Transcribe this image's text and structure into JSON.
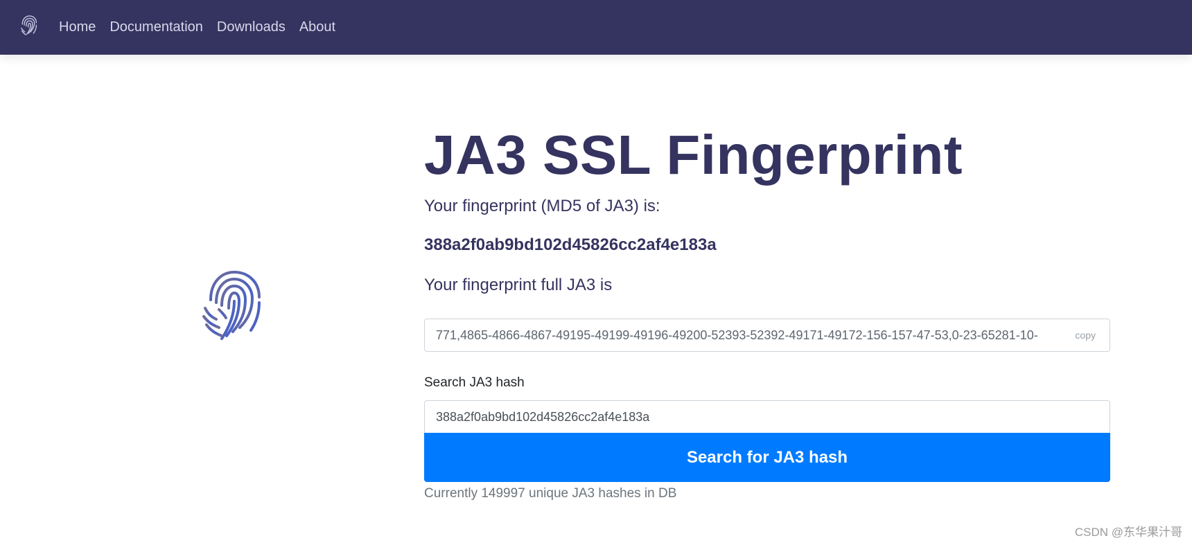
{
  "nav": {
    "logo_icon": "fingerprint-icon",
    "links": [
      "Home",
      "Documentation",
      "Downloads",
      "About"
    ]
  },
  "main": {
    "illustration_icon": "fingerprint-icon",
    "title": "JA3 SSL Fingerprint",
    "md5_label": "Your fingerprint (MD5 of JA3) is:",
    "md5_value": "388a2f0ab9bd102d45826cc2af4e183a",
    "full_label": "Your fingerprint full JA3 is",
    "full_value": "771,4865-4866-4867-49195-49199-49196-49200-52393-52392-49171-49172-156-157-47-53,0-23-65281-10-",
    "copy_label": "copy",
    "search_label": "Search JA3 hash",
    "search_value": "388a2f0ab9bd102d45826cc2af4e183a",
    "search_button": "Search for JA3 hash",
    "db_count": "Currently 149997 unique JA3 hashes in DB"
  },
  "watermark": "CSDN @东华果汁哥",
  "colors": {
    "navbar_bg": "#35335f",
    "title": "#35335f",
    "button_bg": "#007bff"
  }
}
